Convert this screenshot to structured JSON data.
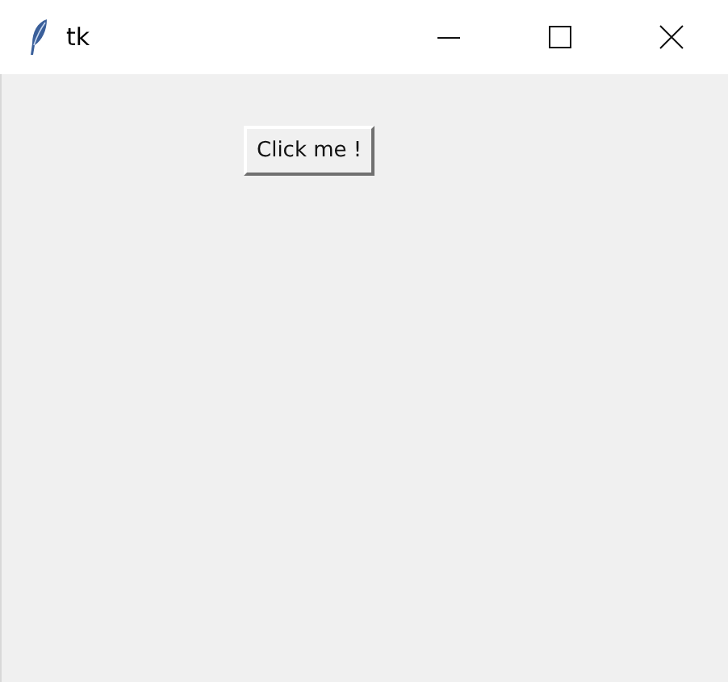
{
  "window": {
    "title": "tk"
  },
  "buttons": [
    {
      "label": "Click me !"
    }
  ]
}
